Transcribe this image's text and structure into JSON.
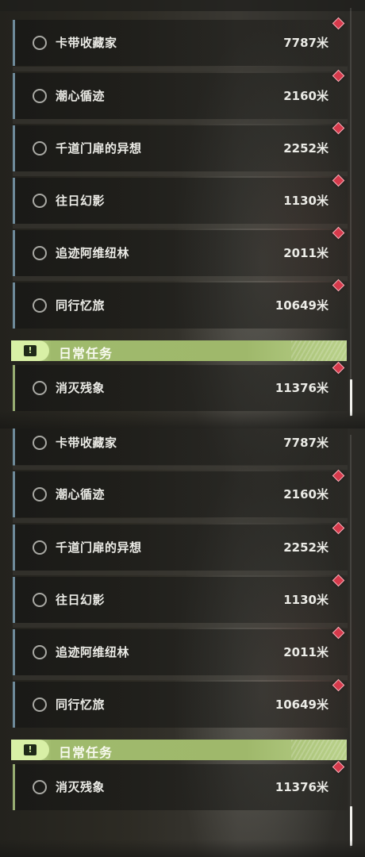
{
  "quests": [
    {
      "name": "卡带收藏家",
      "distance": "7787米"
    },
    {
      "name": "潮心循迹",
      "distance": "2160米"
    },
    {
      "name": "千道门扉的异想",
      "distance": "2252米"
    },
    {
      "name": "往日幻影",
      "distance": "1130米"
    },
    {
      "name": "追迹阿维纽林",
      "distance": "2011米"
    },
    {
      "name": "同行忆旅",
      "distance": "10649米"
    }
  ],
  "daily_section": {
    "title": "日常任务",
    "badge_icon": "exclamation-box-icon",
    "accent_color": "#9fba6c",
    "quest": {
      "name": "消灭残象",
      "distance": "11376米"
    }
  },
  "colors": {
    "quest_bar": "#6e8a9a",
    "daily_bar": "#97ad72",
    "marker": "#d6394b"
  },
  "icons": {
    "status": "circle-outline-icon",
    "marker": "diamond-marker-icon"
  }
}
